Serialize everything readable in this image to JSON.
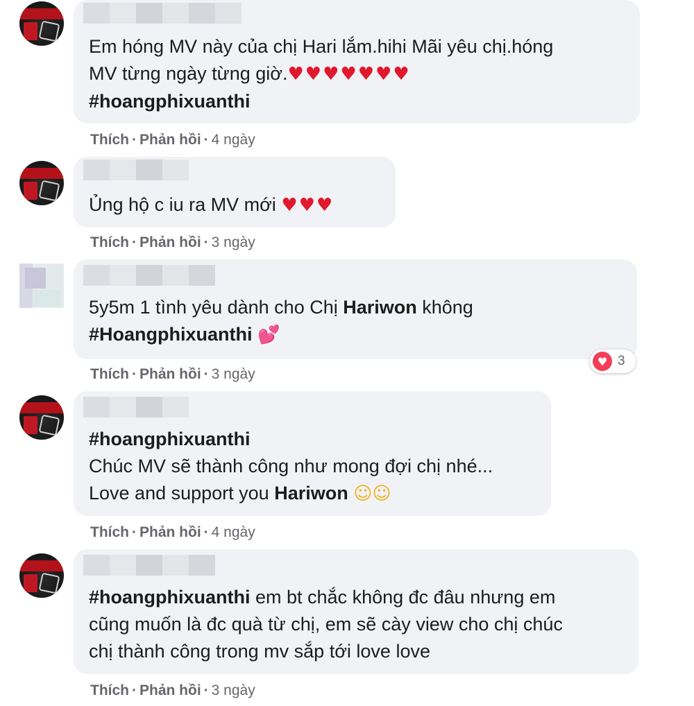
{
  "comments": [
    {
      "text_lines": [
        "Em hóng MV này của chị Hari lắm.hihi Mãi yêu chị.hóng",
        "MV từng ngày từng giờ."
      ],
      "hearts": "♥♥♥♥♥♥♥",
      "hashtag": "#hoangphixuanthi",
      "actions": {
        "like": "Thích",
        "reply": "Phản hồi",
        "time": "4 ngày"
      }
    },
    {
      "text_lines": [
        "Ủng hộ c iu ra MV mới"
      ],
      "hearts": "♥♥♥",
      "actions": {
        "like": "Thích",
        "reply": "Phản hồi",
        "time": "3 ngày"
      }
    },
    {
      "text_prefix": "5y5m 1 tình yêu dành cho Chị ",
      "text_bold": "Hariwon",
      "text_suffix": " không",
      "hashtag": "#Hoangphixuanthi",
      "emoji": "💕",
      "reaction": {
        "icon": "heart-icon",
        "count": "3"
      },
      "actions": {
        "like": "Thích",
        "reply": "Phản hồi",
        "time": "3 ngày"
      }
    },
    {
      "hashtag": "#hoangphixuanthi",
      "text_lines": [
        "Chúc MV sẽ thành công như mong đợi chị nhé..."
      ],
      "text_prefix": "Love and support you ",
      "text_bold": "Hariwon",
      "emoji": "☺☺",
      "actions": {
        "like": "Thích",
        "reply": "Phản hồi",
        "time": "4 ngày"
      }
    },
    {
      "hashtag": "#hoangphixuanthi",
      "text_first_suffix": " em bt chắc không đc đâu nhưng em",
      "text_lines": [
        "cũng muốn là đc quà từ chị, em sẽ cày view cho chị chúc",
        "chị thành công trong mv sắp tới love love"
      ],
      "actions": {
        "like": "Thích",
        "reply": "Phản hồi",
        "time": "3 ngày"
      }
    }
  ],
  "colors": {
    "bubble": "#f0f2f5",
    "meta": "#65676b",
    "heart": "#e0182d",
    "reaction": "#f33e58"
  }
}
